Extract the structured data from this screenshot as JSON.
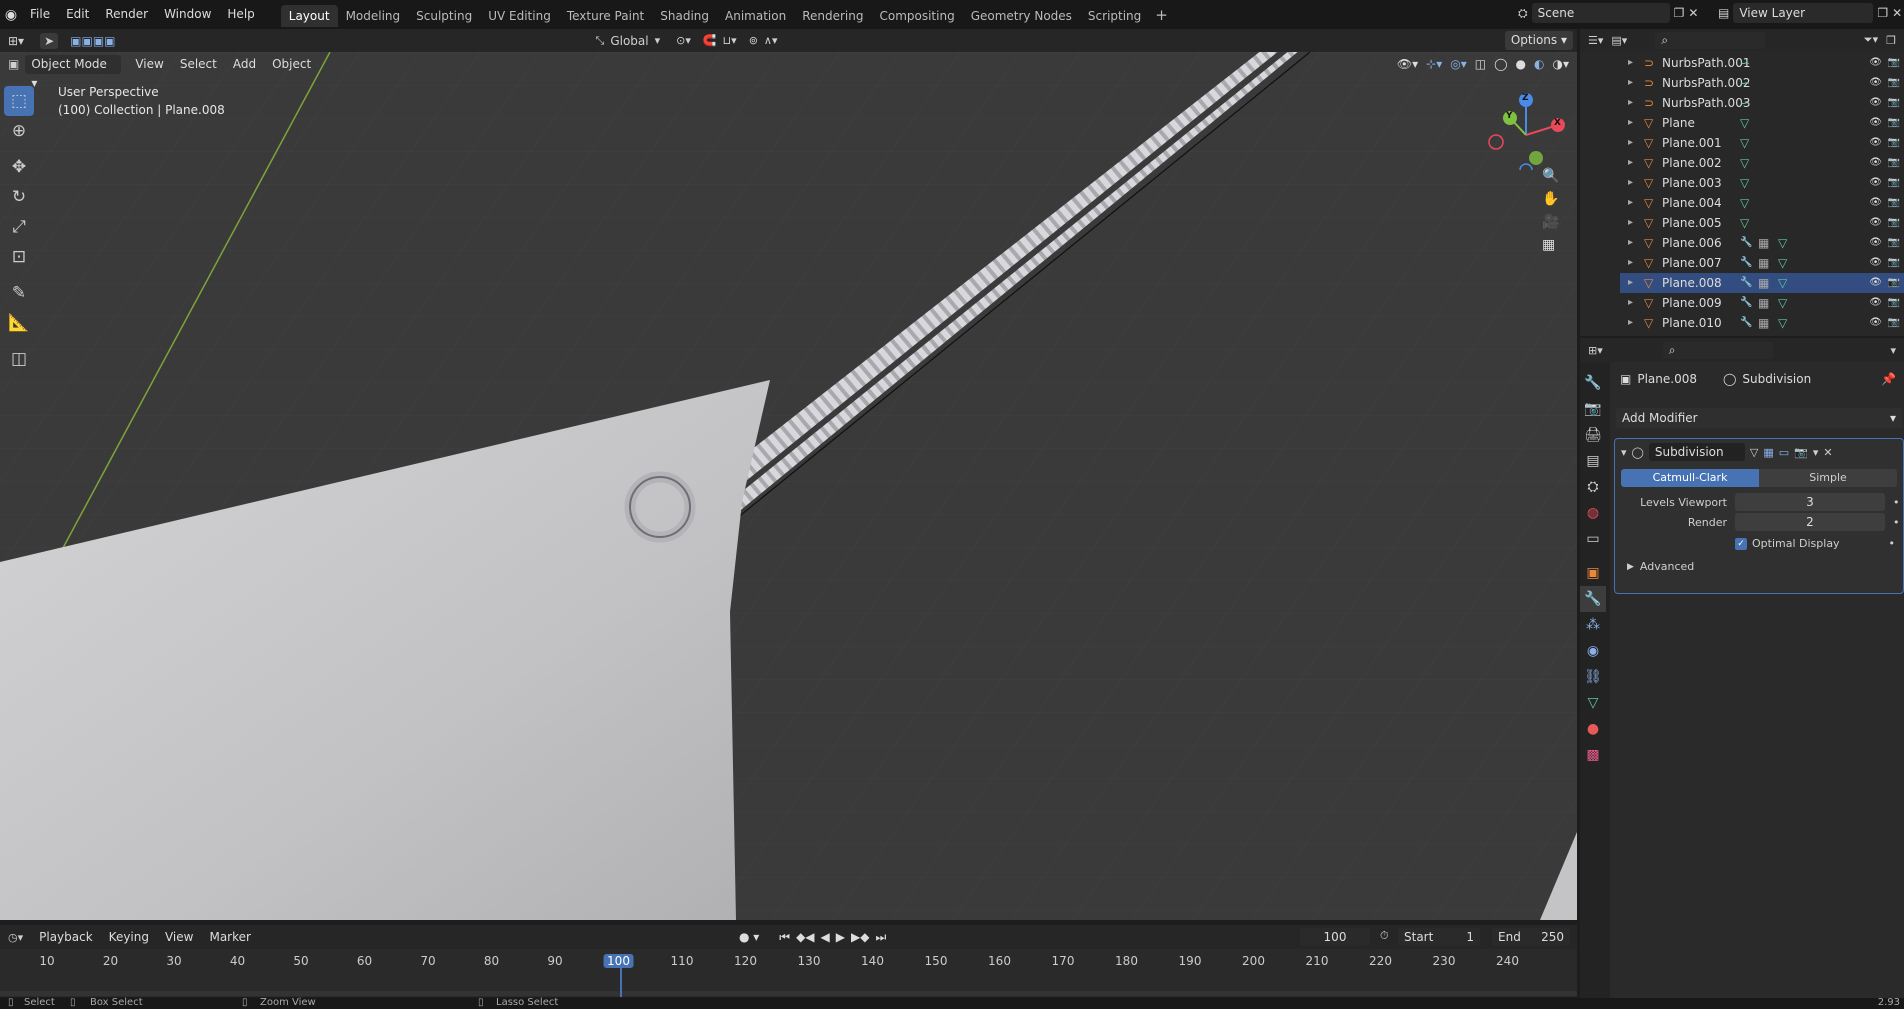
{
  "menus": [
    "File",
    "Edit",
    "Render",
    "Window",
    "Help"
  ],
  "workspaces": [
    "Layout",
    "Modeling",
    "Sculpting",
    "UV Editing",
    "Texture Paint",
    "Shading",
    "Animation",
    "Rendering",
    "Compositing",
    "Geometry Nodes",
    "Scripting"
  ],
  "active_workspace": "Layout",
  "scene": {
    "label": "Scene"
  },
  "view_layer": {
    "label": "View Layer"
  },
  "viewport_header": {
    "mode": "Object Mode",
    "menus": [
      "View",
      "Select",
      "Add",
      "Object"
    ],
    "orientation": "Global",
    "options": "Options"
  },
  "viewport_overlay": {
    "view_name": "User Perspective",
    "collection": "(100) Collection | Plane.008"
  },
  "gizmo": {
    "z": "Z",
    "y": "Y",
    "x": "X"
  },
  "outliner": [
    {
      "name": "NurbsPath.001",
      "type": "curve",
      "mods": false,
      "data": "curve"
    },
    {
      "name": "NurbsPath.002",
      "type": "curve",
      "mods": false,
      "data": "curve"
    },
    {
      "name": "NurbsPath.003",
      "type": "curve",
      "mods": false,
      "data": "curve"
    },
    {
      "name": "Plane",
      "type": "mesh",
      "mods": false,
      "data": "mesh"
    },
    {
      "name": "Plane.001",
      "type": "mesh",
      "mods": false,
      "data": "mesh"
    },
    {
      "name": "Plane.002",
      "type": "mesh",
      "mods": false,
      "data": "mesh"
    },
    {
      "name": "Plane.003",
      "type": "mesh",
      "mods": false,
      "data": "mesh"
    },
    {
      "name": "Plane.004",
      "type": "mesh",
      "mods": false,
      "data": "mesh"
    },
    {
      "name": "Plane.005",
      "type": "mesh",
      "mods": false,
      "data": "mesh"
    },
    {
      "name": "Plane.006",
      "type": "mesh",
      "mods": true,
      "data": "mesh"
    },
    {
      "name": "Plane.007",
      "type": "mesh",
      "mods": true,
      "data": "mesh"
    },
    {
      "name": "Plane.008",
      "type": "mesh",
      "mods": true,
      "data": "mesh",
      "selected": true
    },
    {
      "name": "Plane.009",
      "type": "mesh",
      "mods": true,
      "data": "mesh"
    },
    {
      "name": "Plane.010",
      "type": "mesh",
      "mods": true,
      "data": "mesh"
    }
  ],
  "properties": {
    "object": "Plane.008",
    "modifier_ref": "Subdivision",
    "add_modifier": "Add Modifier",
    "modifier": {
      "name": "Subdivision",
      "mode_a": "Catmull-Clark",
      "mode_b": "Simple",
      "levels_label": "Levels Viewport",
      "levels": "3",
      "render_label": "Render",
      "render": "2",
      "optimal_label": "Optimal Display",
      "optimal": true,
      "advanced": "Advanced"
    }
  },
  "timeline": {
    "menus": [
      "Playback",
      "Keying",
      "View",
      "Marker"
    ],
    "current": "100",
    "start_label": "Start",
    "start": "1",
    "end_label": "End",
    "end": "250",
    "ticks": [
      "10",
      "20",
      "30",
      "40",
      "50",
      "60",
      "70",
      "80",
      "90",
      "100",
      "110",
      "120",
      "130",
      "140",
      "150",
      "160",
      "170",
      "180",
      "190",
      "200",
      "210",
      "220",
      "230",
      "240"
    ]
  },
  "status": {
    "select": "Select",
    "box": "Box Select",
    "zoom": "Zoom View",
    "lasso": "Lasso Select",
    "version": "2.93"
  },
  "colors": {
    "accent": "#4772b3",
    "mesh_icon": "#e8873a",
    "curve_icon": "#5ec8a4",
    "axis_x": "#e84a5a",
    "axis_y": "#80c040",
    "axis_z": "#4a8ae8"
  }
}
